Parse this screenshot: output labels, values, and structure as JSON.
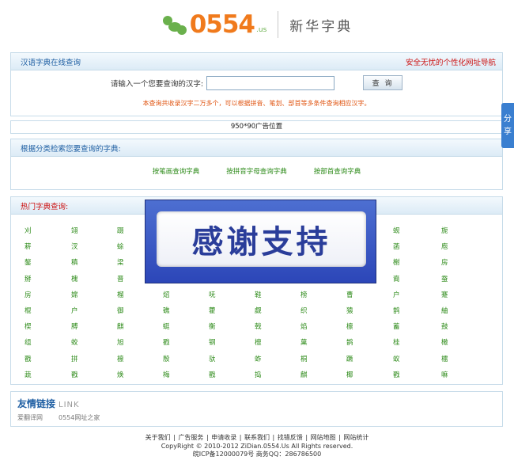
{
  "header": {
    "logo_text": "0554",
    "logo_suffix": ".us",
    "subtitle": "新华字典"
  },
  "search_box": {
    "title": "汉语字典在线查询",
    "right_link": "安全无忧的个性化网址导航",
    "label": "请输入一个您要查询的汉字:",
    "input_value": "",
    "button_label": "查 询",
    "notice": "本查询共收录汉字二万多个，可以根据拼音、笔划、部首等多条件查询相应汉字。"
  },
  "ad": {
    "label": "950*90广告位置"
  },
  "category_box": {
    "title": "根据分类检索您要查询的字典:",
    "links": [
      "按笔画查询字典",
      "按拼音字母查询字典",
      "按部首查询字典"
    ]
  },
  "hot_box": {
    "title": "热门字典查询:",
    "rows": [
      [
        "刈",
        "翊",
        "蹑",
        "",
        "",
        "",
        "",
        "",
        "",
        "蚬",
        "旎"
      ],
      [
        "菥",
        "汊",
        "蜍",
        "",
        "",
        "",
        "",
        "",
        "",
        "菡",
        "庖"
      ],
      [
        "鏊",
        "稹",
        "梁",
        "",
        "",
        "",
        "",
        "",
        "",
        "榭",
        "房"
      ],
      [
        "掰",
        "槐",
        "晋",
        "",
        "",
        "",
        "",
        "",
        "",
        "裔",
        "蚕"
      ],
      [
        "房",
        "嫦",
        "榴",
        "炤",
        "呒",
        "鞋",
        "榜",
        "曹",
        "户",
        "蹇"
      ],
      [
        "棍",
        "户",
        "御",
        "礁",
        "藿",
        "觑",
        "织",
        "猿",
        "鹊",
        "紬"
      ],
      [
        "楔",
        "膊",
        "麒",
        "蜓",
        "衡",
        "戟",
        "焰",
        "檩",
        "蓄",
        "鼓"
      ],
      [
        "组",
        "蛟",
        "旭",
        "戳",
        "钢",
        "檀",
        "菓",
        "鹊",
        "桂",
        "橄"
      ],
      [
        "戳",
        "拼",
        "檩",
        "殷",
        "驮",
        "蚱",
        "桐",
        "蹶",
        "蚁",
        "檑"
      ],
      [
        "蔬",
        "戳",
        "焕",
        "梅",
        "戳",
        "捣",
        "麒",
        "椰",
        "戳",
        "嘛"
      ]
    ]
  },
  "overlay": {
    "text": "感谢支持"
  },
  "friend_links": {
    "title": "友情链接",
    "title_en": "LINK",
    "items": [
      "爱翻译网",
      "0554网址之家"
    ]
  },
  "footer": {
    "nav": [
      "关于我们",
      "广告服务",
      "申请收录",
      "联系我们",
      "找错反馈",
      "网站地图",
      "网站统计"
    ],
    "copyright": "CopyRight © 2010-2012 ZiDian.0554.Us All Rights reserved.",
    "icp": "皖ICP备12000079号 商务QQ：286786500"
  },
  "share_tab": {
    "line1": "分",
    "line2": "享"
  },
  "colors": {
    "accent_blue": "#1f5fa3",
    "link_green": "#2e8b1a",
    "alert_red": "#cc1111",
    "logo_orange": "#f07a1c"
  }
}
